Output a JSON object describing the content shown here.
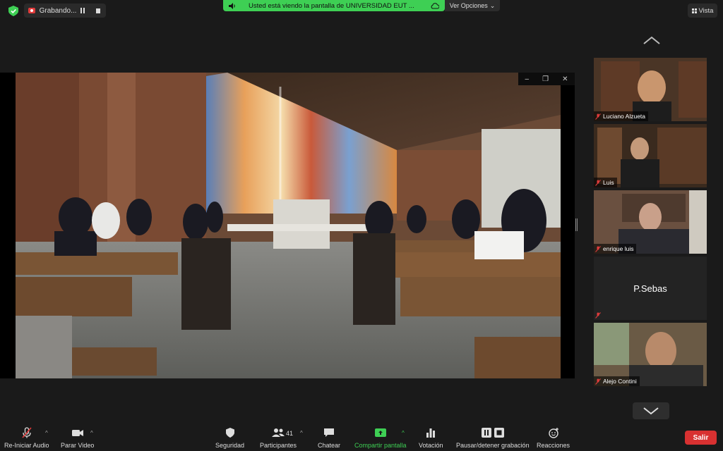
{
  "top": {
    "recording_label": "Grabando...",
    "share_banner": "Usted está viendo la pantalla de UNIVERSIDAD EUT  ...",
    "view_options": "Ver Opciones",
    "view_label": "Vista"
  },
  "participants": [
    {
      "name": "Luciano Alzueta",
      "icon": "mic-off-icon"
    },
    {
      "name": "Luis",
      "icon": "mic-off-icon"
    },
    {
      "name": "enrique luis",
      "icon": "mic-off-icon"
    },
    {
      "name": "P.Sebas",
      "icon": "mic-off-icon",
      "video": false
    },
    {
      "name": "Alejo Contini",
      "icon": "mic-off-icon"
    }
  ],
  "toolbar": {
    "audio_label": "Re-Iniciar Audio",
    "video_label": "Parar Video",
    "security_label": "Seguridad",
    "participants_label": "Participantes",
    "participants_count": "41",
    "chat_label": "Chatear",
    "share_label": "Compartir pantalla",
    "poll_label": "Votación",
    "record_label": "Pausar/detener grabación",
    "reactions_label": "Reacciones",
    "leave_label": "Salir"
  },
  "colors": {
    "accent_green": "#3ecf54",
    "leave_red": "#d83131",
    "background": "#1a1a1a"
  }
}
